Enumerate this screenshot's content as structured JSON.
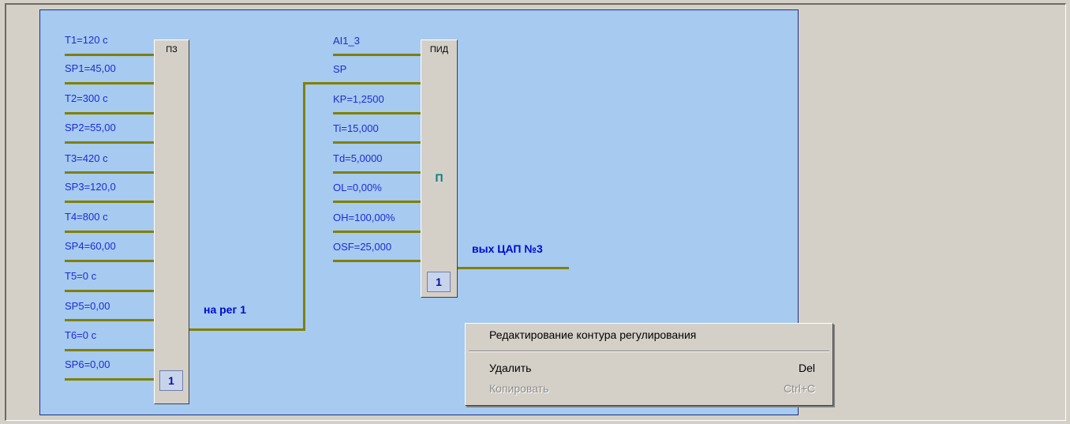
{
  "pz_block": {
    "title": "ПЗ",
    "number": "1",
    "inputs": [
      "T1=120 с",
      "SP1=45,00",
      "T2=300 с",
      "SP2=55,00",
      "T3=420 с",
      "SP3=120,0",
      "T4=800 с",
      "SP4=60,00",
      "T5=0 с",
      "SP5=0,00",
      "T6=0 с",
      "SP6=0,00"
    ],
    "output_label": "на рег 1"
  },
  "pid_block": {
    "title": "ПИД",
    "mode": "П",
    "number": "1",
    "inputs": [
      "AI1_3",
      "SP",
      "KP=1,2500",
      "Ti=15,000",
      "Td=5,0000",
      "OL=0,00%",
      "OH=100,00%",
      "OSF=25,000"
    ],
    "output_label": "вых ЦАП №3"
  },
  "context_menu": {
    "items": [
      {
        "label": "Редактирование контура регулирования",
        "shortcut": "",
        "enabled": true
      },
      {
        "label": "Удалить",
        "shortcut": "Del",
        "enabled": true
      },
      {
        "label": "Копировать",
        "shortcut": "Ctrl+C",
        "enabled": false
      }
    ]
  },
  "colors": {
    "canvas": "#a6caf0",
    "wire": "#808000",
    "label": "#1e2bd6",
    "mode": "#008080"
  }
}
